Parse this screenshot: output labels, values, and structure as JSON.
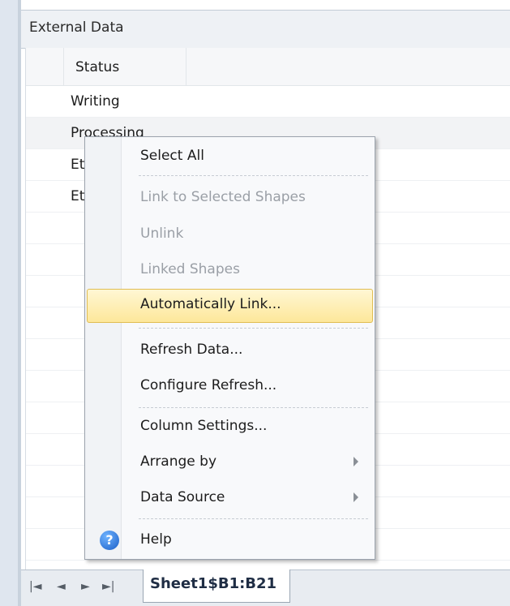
{
  "pane": {
    "title": "External Data"
  },
  "grid": {
    "column_header": "Status",
    "rows": [
      "Writing",
      "Processing",
      "Et",
      "Et"
    ]
  },
  "sheet": {
    "tab_label": "Sheet1$B1:B21",
    "nav": {
      "first": "|◄",
      "prev": "◄",
      "next": "►",
      "last": "►|"
    }
  },
  "menu": {
    "items": [
      {
        "label": "Select All",
        "disabled": false
      },
      {
        "label": "Link to Selected Shapes",
        "disabled": true
      },
      {
        "label": "Unlink",
        "disabled": true
      },
      {
        "label": "Linked Shapes",
        "disabled": true
      },
      {
        "label": "Automatically Link...",
        "disabled": false,
        "highlighted": true
      },
      {
        "label": "Refresh Data...",
        "disabled": false
      },
      {
        "label": "Configure Refresh...",
        "disabled": false
      },
      {
        "label": "Column Settings...",
        "disabled": false
      },
      {
        "label": "Arrange by",
        "disabled": false,
        "submenu": true
      },
      {
        "label": "Data Source",
        "disabled": false,
        "submenu": true
      },
      {
        "label": "Help",
        "disabled": false,
        "icon": "help-icon"
      }
    ],
    "help_icon_glyph": "?"
  },
  "colors": {
    "highlight": "#fde79a",
    "disabled_text": "#9a9fa6"
  }
}
